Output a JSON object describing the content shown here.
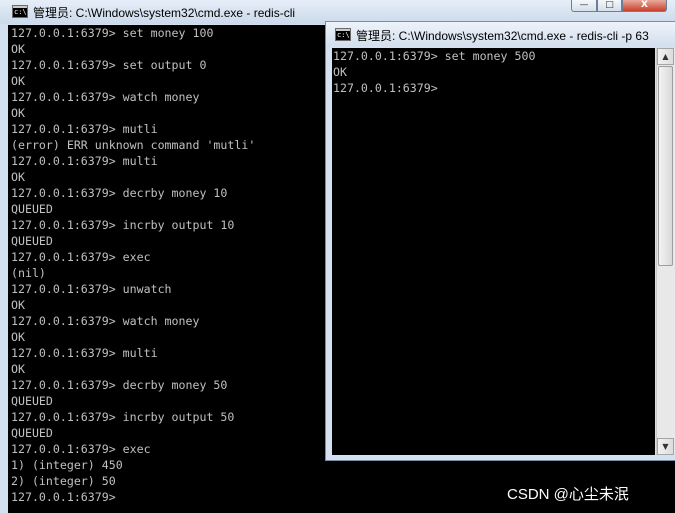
{
  "window_left": {
    "title": "管理员: C:\\Windows\\system32\\cmd.exe - redis-cli",
    "controls": {
      "minimize": "—",
      "maximize": "□",
      "close": "X"
    },
    "lines": [
      "127.0.0.1:6379> set money 100",
      "OK",
      "127.0.0.1:6379> set output 0",
      "OK",
      "127.0.0.1:6379> watch money",
      "OK",
      "127.0.0.1:6379> mutli",
      "(error) ERR unknown command 'mutli'",
      "127.0.0.1:6379> multi",
      "OK",
      "127.0.0.1:6379> decrby money 10",
      "QUEUED",
      "127.0.0.1:6379> incrby output 10",
      "QUEUED",
      "127.0.0.1:6379> exec",
      "(nil)",
      "127.0.0.1:6379> unwatch",
      "OK",
      "127.0.0.1:6379> watch money",
      "OK",
      "127.0.0.1:6379> multi",
      "OK",
      "127.0.0.1:6379> decrby money 50",
      "QUEUED",
      "127.0.0.1:6379> incrby output 50",
      "QUEUED",
      "127.0.0.1:6379> exec",
      "1) (integer) 450",
      "2) (integer) 50",
      "127.0.0.1:6379>"
    ]
  },
  "window_right": {
    "title": "管理员: C:\\Windows\\system32\\cmd.exe - redis-cli  -p 63",
    "lines": [
      "127.0.0.1:6379> set money 500",
      "OK",
      "127.0.0.1:6379>"
    ],
    "scrollbar": {
      "up": "▲",
      "down": "▼"
    }
  },
  "watermark": "CSDN @心尘未泯"
}
